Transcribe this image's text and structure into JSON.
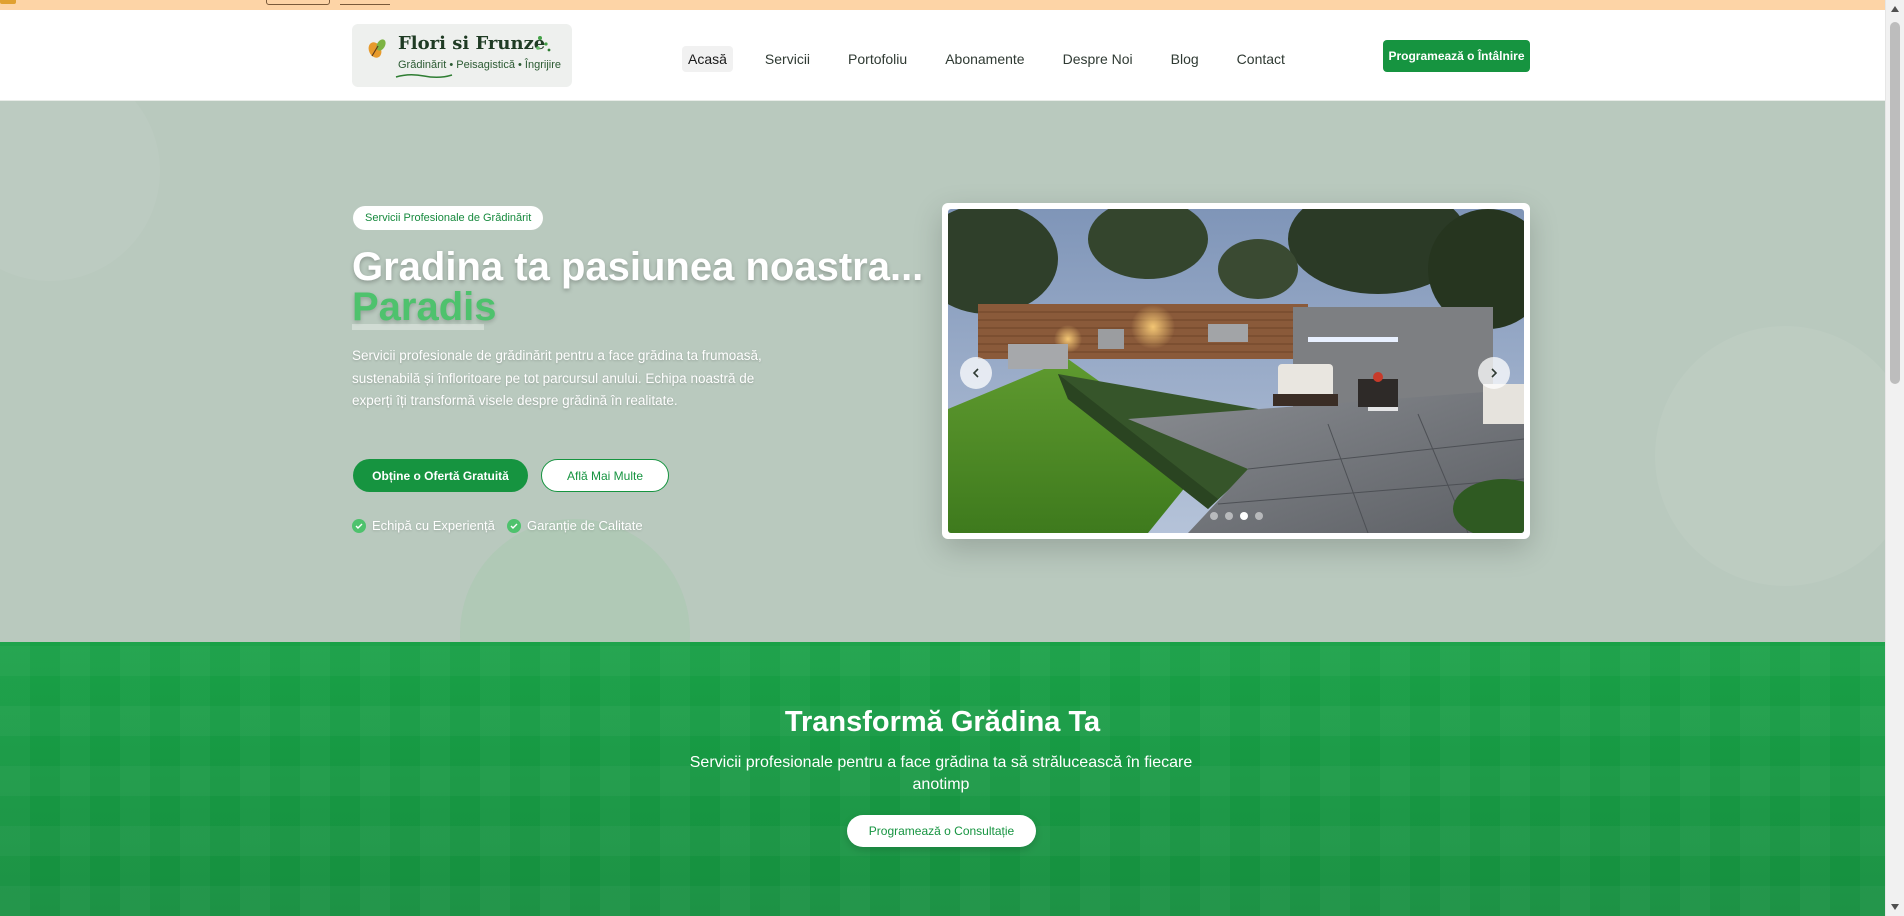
{
  "header": {
    "logo": {
      "brand": "Flori si Frunze",
      "tagline": "Grădinărit • Peisagistică • Îngrijire"
    },
    "nav": [
      {
        "label": "Acasă",
        "active": true
      },
      {
        "label": "Servicii"
      },
      {
        "label": "Portofoliu"
      },
      {
        "label": "Abonamente"
      },
      {
        "label": "Despre Noi"
      },
      {
        "label": "Blog"
      },
      {
        "label": "Contact"
      }
    ],
    "cta_label": "Programează o Întâlnire"
  },
  "hero": {
    "badge": "Servicii Profesionale de Grădinărit",
    "title": "Gradina ta pasiunea noastra...",
    "highlight": "Paradis",
    "description": "Servicii profesionale de grădinărit pentru a face grădina ta frumoasă, sustenabilă și înfloritoare pe tot parcursul anului. Echipa noastră de experți îți transformă visele despre grădină în realitate.",
    "primary_button": "Obține o Ofertă Gratuită",
    "secondary_button": "Află Mai Multe",
    "features": [
      "Echipă cu Experiență",
      "Garanție de Calitate"
    ],
    "carousel": {
      "slide_count": 4,
      "active_index": 2
    }
  },
  "cta_section": {
    "title": "Transformă Grădina Ta",
    "subtitle": "Servicii profesionale pentru a face grădina ta să strălucească în fiecare anotimp",
    "button": "Programează o Consultație"
  },
  "colors": {
    "brand_green": "#169440",
    "highlight_green": "#4ec26d",
    "hero_bg": "#b9c9be",
    "top_strip": "#fdd4a6"
  },
  "icons": [
    "leaf-icon",
    "sparkle-icon",
    "check-icon",
    "chevron-left-icon",
    "chevron-right-icon"
  ]
}
